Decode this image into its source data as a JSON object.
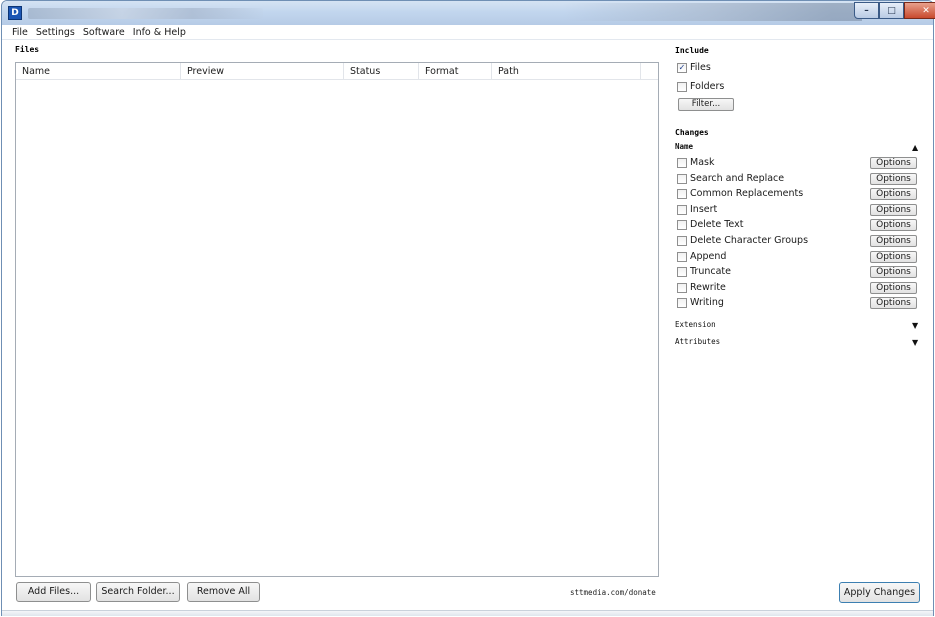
{
  "window": {
    "icon_letter": "D",
    "controls": {
      "minimize": "–",
      "maximize": "□",
      "close": "✕"
    }
  },
  "menu": {
    "items": [
      "File",
      "Settings",
      "Software",
      "Info & Help"
    ]
  },
  "files": {
    "section_title": "Files",
    "columns": [
      "Name",
      "Preview",
      "Status",
      "Format",
      "Path"
    ],
    "rows": []
  },
  "bottom": {
    "add_files": "Add Files...",
    "search_folder": "Search Folder...",
    "remove_all": "Remove All",
    "donate": "sttmedia.com/donate",
    "apply": "Apply Changes"
  },
  "include": {
    "title": "Include",
    "files_label": "Files",
    "files_checked": true,
    "folders_label": "Folders",
    "folders_checked": false,
    "filter_label": "Filter..."
  },
  "changes": {
    "title": "Changes",
    "name_group": "Name",
    "name_group_expanded": true,
    "options_label": "Options",
    "items": [
      {
        "label": "Mask",
        "checked": false
      },
      {
        "label": "Search and Replace",
        "checked": false
      },
      {
        "label": "Common Replacements",
        "checked": false
      },
      {
        "label": "Insert",
        "checked": false
      },
      {
        "label": "Delete Text",
        "checked": false
      },
      {
        "label": "Delete Character Groups",
        "checked": false
      },
      {
        "label": "Append",
        "checked": false
      },
      {
        "label": "Truncate",
        "checked": false
      },
      {
        "label": "Rewrite",
        "checked": false
      },
      {
        "label": "Writing",
        "checked": false
      }
    ],
    "extension_group": "Extension",
    "attributes_group": "Attributes",
    "icons": {
      "collapse": "triangle-up-icon",
      "expand": "triangle-down-icon"
    }
  }
}
